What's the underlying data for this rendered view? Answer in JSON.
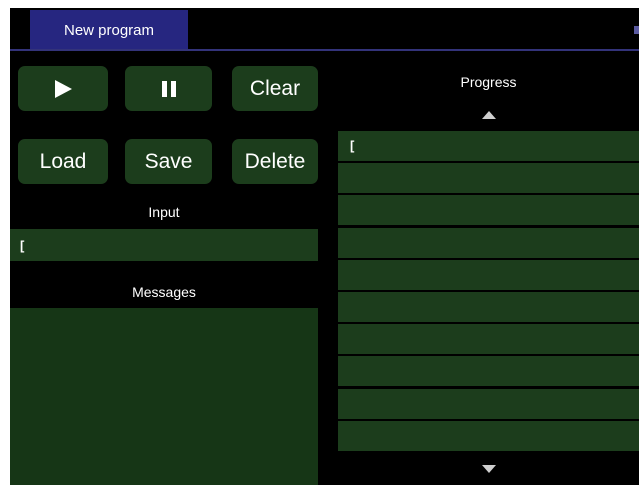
{
  "tab": {
    "label": "New program"
  },
  "controls": {
    "clear_label": "Clear",
    "load_label": "Load",
    "save_label": "Save",
    "delete_label": "Delete"
  },
  "input": {
    "label": "Input",
    "value": "["
  },
  "messages": {
    "label": "Messages"
  },
  "progress": {
    "label": "Progress",
    "rows": [
      "[",
      "",
      "",
      "",
      "",
      "",
      "",
      "",
      "",
      ""
    ]
  },
  "colors": {
    "background": "#000000",
    "panel_green": "#1c3d1c",
    "tab_blue": "#262680"
  },
  "icons": {
    "play": "play-icon",
    "pause": "pause-icon",
    "scroll_up": "triangle-up-icon",
    "scroll_down": "triangle-down-icon"
  }
}
